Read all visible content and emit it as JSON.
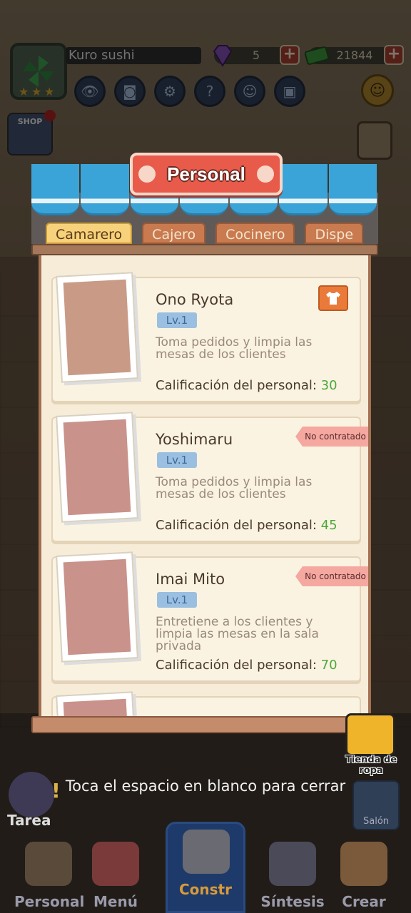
{
  "hud": {
    "player_name": "Kuro sushi",
    "gems": "5",
    "cash": "21844"
  },
  "modal": {
    "title": "Personal",
    "tabs": [
      {
        "label": "Camarero",
        "active": true
      },
      {
        "label": "Cajero",
        "active": false
      },
      {
        "label": "Cocinero",
        "active": false
      },
      {
        "label": "Dispe",
        "active": false
      }
    ],
    "staff": [
      {
        "name": "Ono Ryota",
        "level": "Lv.1",
        "description": "Toma pedidos y limpia las mesas de los clientes",
        "rating_label": "Calificación del personal:",
        "rating_value": "30",
        "status": ""
      },
      {
        "name": "Yoshimaru",
        "level": "Lv.1",
        "description": "Toma pedidos y limpia las mesas de los clientes",
        "rating_label": "Calificación del personal:",
        "rating_value": "45",
        "status": "No contratado"
      },
      {
        "name": "Imai Mito",
        "level": "Lv.1",
        "description": "Entretiene a los clientes y limpia las mesas en la sala privada",
        "rating_label": "Calificación del personal:",
        "rating_value": "70",
        "status": "No contratado"
      }
    ]
  },
  "close_hint": "Toca el espacio en blanco para cerrar",
  "side": {
    "shop_label": "SHOP",
    "tarea_label": "Tarea",
    "salon_label": "Salón",
    "tienda_label": "Tienda de ropa"
  },
  "bottom_nav": [
    {
      "label": "Personal"
    },
    {
      "label": "Menú"
    },
    {
      "label": "Constr"
    },
    {
      "label": "Síntesis"
    },
    {
      "label": "Crear"
    }
  ],
  "colors": {
    "accent_red": "#e85a4a",
    "awning_blue": "#3aa4d8",
    "rating_green": "#4aa83a",
    "active_tab": "#f7d27a"
  }
}
